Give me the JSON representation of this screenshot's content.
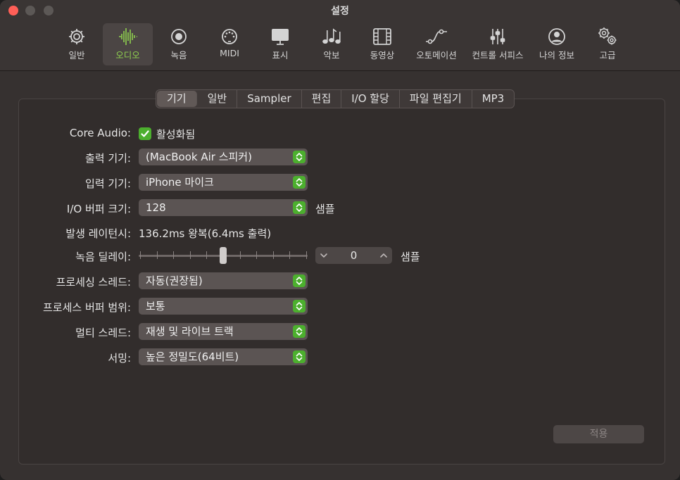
{
  "window": {
    "title": "설정"
  },
  "toolbar": {
    "items": [
      {
        "label": "일반",
        "icon": "gear-icon"
      },
      {
        "label": "오디오",
        "icon": "waveform-icon",
        "active": true
      },
      {
        "label": "녹음",
        "icon": "record-icon"
      },
      {
        "label": "MIDI",
        "icon": "midi-port-icon"
      },
      {
        "label": "표시",
        "icon": "display-icon"
      },
      {
        "label": "악보",
        "icon": "music-notes-icon"
      },
      {
        "label": "동영상",
        "icon": "film-icon"
      },
      {
        "label": "오토메이션",
        "icon": "automation-curve-icon"
      },
      {
        "label": "컨트롤 서피스",
        "icon": "sliders-icon"
      },
      {
        "label": "나의 정보",
        "icon": "person-icon"
      },
      {
        "label": "고급",
        "icon": "gears-icon"
      }
    ]
  },
  "tabs": [
    "기기",
    "일반",
    "Sampler",
    "편집",
    "I/O 할당",
    "파일 편집기",
    "MP3"
  ],
  "tabs_active": "기기",
  "form": {
    "core_audio": {
      "label": "Core Audio:",
      "checkbox_label": "활성화됨",
      "checked": true
    },
    "output_device": {
      "label": "출력 기기:",
      "value": "(MacBook Air 스피커)"
    },
    "input_device": {
      "label": "입력 기기:",
      "value": "iPhone 마이크"
    },
    "io_buffer": {
      "label": "I/O 버퍼 크기:",
      "value": "128",
      "unit": "샘플"
    },
    "latency": {
      "label": "발생 레이턴시:",
      "value": "136.2ms 왕복(6.4ms 출력)"
    },
    "record_delay": {
      "label": "녹음 딜레이:",
      "value": "0",
      "unit": "샘플",
      "slider_fraction": 0.5
    },
    "process_threads": {
      "label": "프로세싱 스레드:",
      "value": "자동(권장됨)"
    },
    "process_buffer": {
      "label": "프로세스 버퍼 범위:",
      "value": "보통"
    },
    "multithreading": {
      "label": "멀티 스레드:",
      "value": "재생 및 라이브 트랙"
    },
    "summing": {
      "label": "서밍:",
      "value": "높은 정밀도(64비트)"
    }
  },
  "apply_button": {
    "label": "적용",
    "enabled": false
  },
  "colors": {
    "accent": "#8fd14f",
    "checkbox": "#4caf2e"
  }
}
